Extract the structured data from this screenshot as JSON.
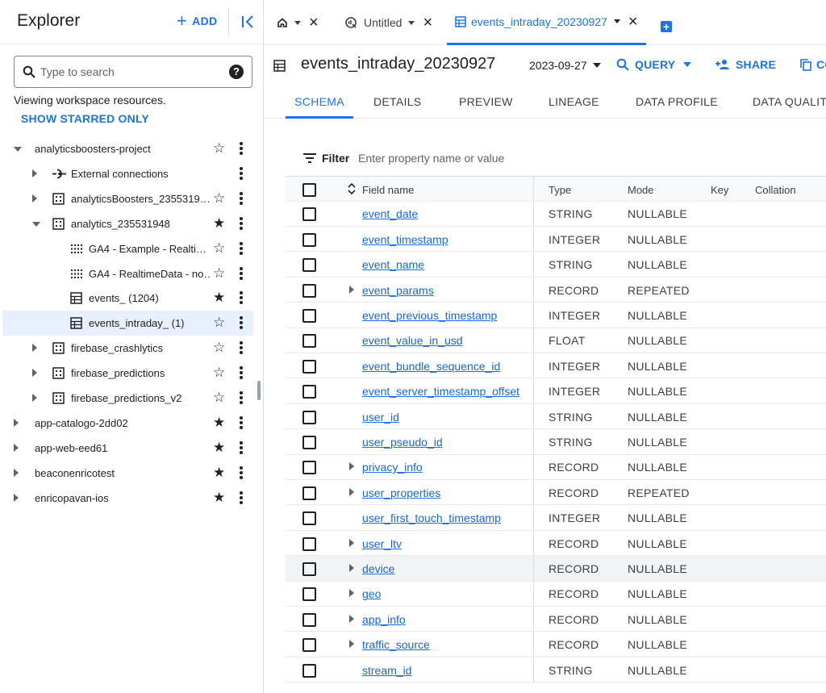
{
  "explorer": {
    "title": "Explorer",
    "add_label": "ADD",
    "search_placeholder": "Type to search",
    "viewing_text": "Viewing workspace resources.",
    "show_starred": "SHOW STARRED ONLY",
    "tree": [
      {
        "label": "analyticsboosters-project",
        "level": 0,
        "arrow": "down",
        "icon": "none",
        "star": "outline"
      },
      {
        "label": "External connections",
        "level": 1,
        "arrow": "right",
        "icon": "connection-icon",
        "star": "none"
      },
      {
        "label": "analyticsBoosters_2355319…",
        "level": 1,
        "arrow": "right",
        "icon": "dataset-icon",
        "star": "outline"
      },
      {
        "label": "analytics_235531948",
        "level": 1,
        "arrow": "down",
        "icon": "dataset-icon",
        "star": "filled"
      },
      {
        "label": "GA4 - Example - Realti…",
        "level": 2,
        "arrow": "none",
        "icon": "view-icon",
        "star": "outline"
      },
      {
        "label": "GA4 - RealtimeData - no…",
        "level": 2,
        "arrow": "none",
        "icon": "view-icon",
        "star": "outline"
      },
      {
        "label": "events_ (1204)",
        "level": 2,
        "arrow": "none",
        "icon": "table-icon",
        "star": "filled"
      },
      {
        "label": "events_intraday_ (1)",
        "level": 2,
        "arrow": "none",
        "icon": "table-icon",
        "star": "outline",
        "selected": true
      },
      {
        "label": "firebase_crashlytics",
        "level": 1,
        "arrow": "right",
        "icon": "dataset-icon",
        "star": "outline"
      },
      {
        "label": "firebase_predictions",
        "level": 1,
        "arrow": "right",
        "icon": "dataset-icon",
        "star": "outline"
      },
      {
        "label": "firebase_predictions_v2",
        "level": 1,
        "arrow": "right",
        "icon": "dataset-icon",
        "star": "outline"
      },
      {
        "label": "app-catalogo-2dd02",
        "level": 0,
        "arrow": "right",
        "icon": "none",
        "star": "filled"
      },
      {
        "label": "app-web-eed61",
        "level": 0,
        "arrow": "right",
        "icon": "none",
        "star": "filled"
      },
      {
        "label": "beaconenricotest",
        "level": 0,
        "arrow": "right",
        "icon": "none",
        "star": "filled"
      },
      {
        "label": "enricopavan-ios",
        "level": 0,
        "arrow": "right",
        "icon": "none",
        "star": "filled"
      }
    ]
  },
  "tabs": [
    {
      "label": "",
      "icon": "home-icon"
    },
    {
      "label": "Untitled",
      "icon": "query-icon"
    },
    {
      "label": "events_intraday_20230927",
      "icon": "table-icon",
      "active": true
    }
  ],
  "table_title": "events_intraday_20230927",
  "date_value": "2023-09-27",
  "actions": {
    "query": "QUERY",
    "share": "SHARE",
    "copy": "CO"
  },
  "subtabs": [
    "SCHEMA",
    "DETAILS",
    "PREVIEW",
    "LINEAGE",
    "DATA PROFILE",
    "DATA QUALITY"
  ],
  "filter": {
    "label": "Filter",
    "placeholder": "Enter property name or value"
  },
  "schema": {
    "headers": {
      "field": "Field name",
      "type": "Type",
      "mode": "Mode",
      "key": "Key",
      "collation": "Collation"
    },
    "rows": [
      {
        "name": "event_date",
        "type": "STRING",
        "mode": "NULLABLE",
        "expandable": false
      },
      {
        "name": "event_timestamp",
        "type": "INTEGER",
        "mode": "NULLABLE",
        "expandable": false
      },
      {
        "name": "event_name",
        "type": "STRING",
        "mode": "NULLABLE",
        "expandable": false
      },
      {
        "name": "event_params",
        "type": "RECORD",
        "mode": "REPEATED",
        "expandable": true
      },
      {
        "name": "event_previous_timestamp",
        "type": "INTEGER",
        "mode": "NULLABLE",
        "expandable": false
      },
      {
        "name": "event_value_in_usd",
        "type": "FLOAT",
        "mode": "NULLABLE",
        "expandable": false
      },
      {
        "name": "event_bundle_sequence_id",
        "type": "INTEGER",
        "mode": "NULLABLE",
        "expandable": false
      },
      {
        "name": "event_server_timestamp_offset",
        "type": "INTEGER",
        "mode": "NULLABLE",
        "expandable": false
      },
      {
        "name": "user_id",
        "type": "STRING",
        "mode": "NULLABLE",
        "expandable": false
      },
      {
        "name": "user_pseudo_id",
        "type": "STRING",
        "mode": "NULLABLE",
        "expandable": false
      },
      {
        "name": "privacy_info",
        "type": "RECORD",
        "mode": "NULLABLE",
        "expandable": true
      },
      {
        "name": "user_properties",
        "type": "RECORD",
        "mode": "REPEATED",
        "expandable": true
      },
      {
        "name": "user_first_touch_timestamp",
        "type": "INTEGER",
        "mode": "NULLABLE",
        "expandable": false
      },
      {
        "name": "user_ltv",
        "type": "RECORD",
        "mode": "NULLABLE",
        "expandable": true
      },
      {
        "name": "device",
        "type": "RECORD",
        "mode": "NULLABLE",
        "expandable": true,
        "hover": true
      },
      {
        "name": "geo",
        "type": "RECORD",
        "mode": "NULLABLE",
        "expandable": true
      },
      {
        "name": "app_info",
        "type": "RECORD",
        "mode": "NULLABLE",
        "expandable": true
      },
      {
        "name": "traffic_source",
        "type": "RECORD",
        "mode": "NULLABLE",
        "expandable": true
      },
      {
        "name": "stream_id",
        "type": "STRING",
        "mode": "NULLABLE",
        "expandable": false
      }
    ]
  },
  "colors": {
    "accent": "#1a73e8",
    "selected_bg": "#e8f0fe",
    "link": "#1967d2"
  }
}
